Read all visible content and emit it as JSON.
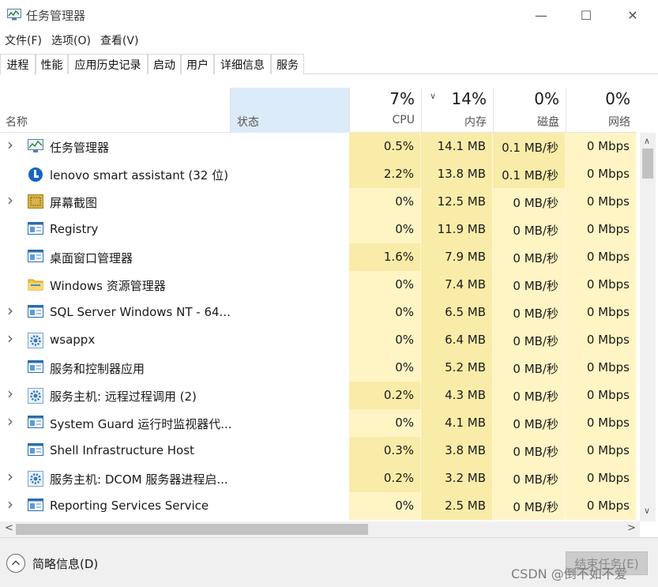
{
  "window": {
    "title": "任务管理器",
    "minimize_glyph": "—",
    "maximize_glyph": "☐",
    "close_glyph": "✕"
  },
  "menu": [
    "文件(F)",
    "选项(O)",
    "查看(V)"
  ],
  "tabs": [
    "进程",
    "性能",
    "应用历史记录",
    "启动",
    "用户",
    "详细信息",
    "服务"
  ],
  "columns": {
    "name": "名称",
    "status": "状态",
    "cpu": {
      "percent": "7%",
      "label": "CPU"
    },
    "memory": {
      "percent": "14%",
      "label": "内存"
    },
    "disk": {
      "percent": "0%",
      "label": "磁盘"
    },
    "network": {
      "percent": "0%",
      "label": "网络"
    }
  },
  "processes": [
    {
      "name": "任务管理器",
      "expandable": true,
      "icon": "task-manager-icon",
      "cpu": "0.5%",
      "memory": "14.1 MB",
      "disk": "0.1 MB/秒",
      "network": "0 Mbps"
    },
    {
      "name": "lenovo smart assistant (32 位)",
      "expandable": false,
      "icon": "lenovo-assistant-icon",
      "cpu": "2.2%",
      "memory": "13.8 MB",
      "disk": "0.1 MB/秒",
      "network": "0 Mbps"
    },
    {
      "name": "屏幕截图",
      "expandable": true,
      "icon": "screenshot-icon",
      "cpu": "0%",
      "memory": "12.5 MB",
      "disk": "0 MB/秒",
      "network": "0 Mbps"
    },
    {
      "name": "Registry",
      "expandable": false,
      "icon": "window-app-icon",
      "cpu": "0%",
      "memory": "11.9 MB",
      "disk": "0 MB/秒",
      "network": "0 Mbps"
    },
    {
      "name": "桌面窗口管理器",
      "expandable": false,
      "icon": "window-app-icon",
      "cpu": "1.6%",
      "memory": "7.9 MB",
      "disk": "0 MB/秒",
      "network": "0 Mbps"
    },
    {
      "name": "Windows 资源管理器",
      "expandable": false,
      "icon": "folder-icon",
      "cpu": "0%",
      "memory": "7.4 MB",
      "disk": "0 MB/秒",
      "network": "0 Mbps"
    },
    {
      "name": "SQL Server Windows NT - 64...",
      "expandable": true,
      "icon": "window-app-icon",
      "cpu": "0%",
      "memory": "6.5 MB",
      "disk": "0 MB/秒",
      "network": "0 Mbps"
    },
    {
      "name": "wsappx",
      "expandable": true,
      "icon": "gear-icon",
      "cpu": "0%",
      "memory": "6.4 MB",
      "disk": "0 MB/秒",
      "network": "0 Mbps"
    },
    {
      "name": "服务和控制器应用",
      "expandable": false,
      "icon": "window-app-icon",
      "cpu": "0%",
      "memory": "5.2 MB",
      "disk": "0 MB/秒",
      "network": "0 Mbps"
    },
    {
      "name": "服务主机: 远程过程调用 (2)",
      "expandable": true,
      "icon": "gear-icon",
      "cpu": "0.2%",
      "memory": "4.3 MB",
      "disk": "0 MB/秒",
      "network": "0 Mbps"
    },
    {
      "name": "System Guard 运行时监视器代...",
      "expandable": true,
      "icon": "window-app-icon",
      "cpu": "0%",
      "memory": "4.1 MB",
      "disk": "0 MB/秒",
      "network": "0 Mbps"
    },
    {
      "name": "Shell Infrastructure Host",
      "expandable": false,
      "icon": "window-app-icon",
      "cpu": "0.3%",
      "memory": "3.8 MB",
      "disk": "0 MB/秒",
      "network": "0 Mbps"
    },
    {
      "name": "服务主机: DCOM 服务器进程启...",
      "expandable": true,
      "icon": "gear-icon",
      "cpu": "0.2%",
      "memory": "3.2 MB",
      "disk": "0 MB/秒",
      "network": "0 Mbps"
    },
    {
      "name": "Reporting Services Service",
      "expandable": true,
      "icon": "window-app-icon",
      "cpu": "0%",
      "memory": "2.5 MB",
      "disk": "0 MB/秒",
      "network": "0 Mbps"
    }
  ],
  "footer": {
    "fewer_details": "简略信息(D)",
    "end_task": "结束任务(E)",
    "watermark": "CSDN @倒不如不爱"
  },
  "colors": {
    "usage_light": "#fff4c4",
    "usage_mid": "#f9eca8",
    "status_header": "#dcebf9"
  }
}
